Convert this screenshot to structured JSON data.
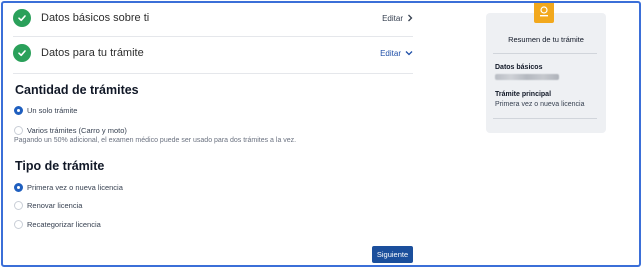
{
  "steps": [
    {
      "title": "Datos básicos sobre ti",
      "edit_label": "Editar",
      "status_icon": "check-icon",
      "toggle_icon": "chevron-right-icon"
    },
    {
      "title": "Datos para tu trámite",
      "edit_label": "Editar",
      "status_icon": "check-icon",
      "toggle_icon": "chevron-down-icon"
    }
  ],
  "quantity": {
    "title": "Cantidad de trámites",
    "options": [
      {
        "label": "Un solo trámite",
        "selected": true
      },
      {
        "label": "Varios trámites (Carro y moto)",
        "selected": false
      }
    ],
    "help": "Pagando un 50% adicional, el examen médico puede ser usado para dos trámites a la vez."
  },
  "type": {
    "title": "Tipo de trámite",
    "options": [
      {
        "label": "Primera vez o nueva licencia",
        "selected": true
      },
      {
        "label": "Renovar licencia",
        "selected": false
      },
      {
        "label": "Recategorizar licencia",
        "selected": false
      }
    ]
  },
  "next_label": "Siguiente",
  "summary": {
    "badge_icon": "license-badge-icon",
    "title": "Resumen de tu trámite",
    "basic_label": "Datos básicos",
    "main_label": "Trámite principal",
    "main_value": "Primera vez o nueva licencia"
  },
  "colors": {
    "accent": "#1b4f9c",
    "success": "#2aa05a",
    "badge": "#f2a81c",
    "frame": "#3b6fd8"
  }
}
